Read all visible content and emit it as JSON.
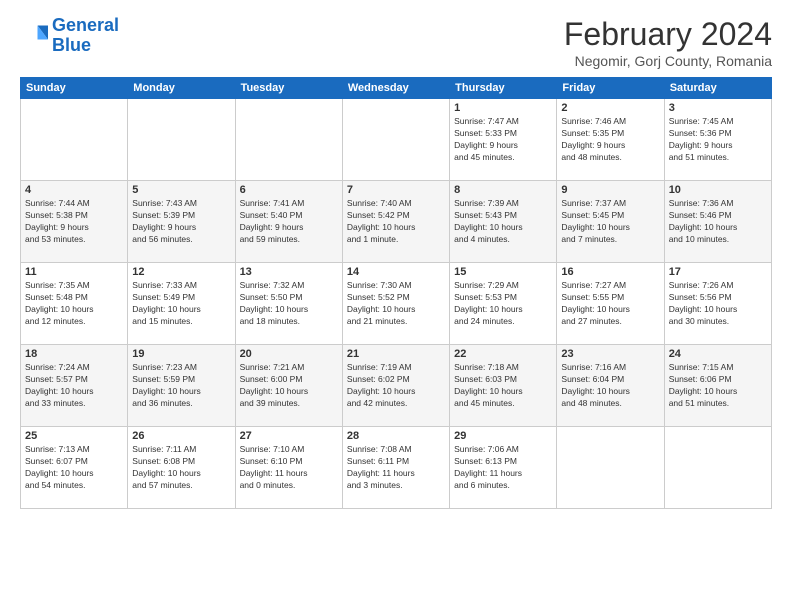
{
  "header": {
    "logo_line1": "General",
    "logo_line2": "Blue",
    "title": "February 2024",
    "subtitle": "Negomir, Gorj County, Romania"
  },
  "weekdays": [
    "Sunday",
    "Monday",
    "Tuesday",
    "Wednesday",
    "Thursday",
    "Friday",
    "Saturday"
  ],
  "weeks": [
    [
      {
        "day": "",
        "info": ""
      },
      {
        "day": "",
        "info": ""
      },
      {
        "day": "",
        "info": ""
      },
      {
        "day": "",
        "info": ""
      },
      {
        "day": "1",
        "info": "Sunrise: 7:47 AM\nSunset: 5:33 PM\nDaylight: 9 hours\nand 45 minutes."
      },
      {
        "day": "2",
        "info": "Sunrise: 7:46 AM\nSunset: 5:35 PM\nDaylight: 9 hours\nand 48 minutes."
      },
      {
        "day": "3",
        "info": "Sunrise: 7:45 AM\nSunset: 5:36 PM\nDaylight: 9 hours\nand 51 minutes."
      }
    ],
    [
      {
        "day": "4",
        "info": "Sunrise: 7:44 AM\nSunset: 5:38 PM\nDaylight: 9 hours\nand 53 minutes."
      },
      {
        "day": "5",
        "info": "Sunrise: 7:43 AM\nSunset: 5:39 PM\nDaylight: 9 hours\nand 56 minutes."
      },
      {
        "day": "6",
        "info": "Sunrise: 7:41 AM\nSunset: 5:40 PM\nDaylight: 9 hours\nand 59 minutes."
      },
      {
        "day": "7",
        "info": "Sunrise: 7:40 AM\nSunset: 5:42 PM\nDaylight: 10 hours\nand 1 minute."
      },
      {
        "day": "8",
        "info": "Sunrise: 7:39 AM\nSunset: 5:43 PM\nDaylight: 10 hours\nand 4 minutes."
      },
      {
        "day": "9",
        "info": "Sunrise: 7:37 AM\nSunset: 5:45 PM\nDaylight: 10 hours\nand 7 minutes."
      },
      {
        "day": "10",
        "info": "Sunrise: 7:36 AM\nSunset: 5:46 PM\nDaylight: 10 hours\nand 10 minutes."
      }
    ],
    [
      {
        "day": "11",
        "info": "Sunrise: 7:35 AM\nSunset: 5:48 PM\nDaylight: 10 hours\nand 12 minutes."
      },
      {
        "day": "12",
        "info": "Sunrise: 7:33 AM\nSunset: 5:49 PM\nDaylight: 10 hours\nand 15 minutes."
      },
      {
        "day": "13",
        "info": "Sunrise: 7:32 AM\nSunset: 5:50 PM\nDaylight: 10 hours\nand 18 minutes."
      },
      {
        "day": "14",
        "info": "Sunrise: 7:30 AM\nSunset: 5:52 PM\nDaylight: 10 hours\nand 21 minutes."
      },
      {
        "day": "15",
        "info": "Sunrise: 7:29 AM\nSunset: 5:53 PM\nDaylight: 10 hours\nand 24 minutes."
      },
      {
        "day": "16",
        "info": "Sunrise: 7:27 AM\nSunset: 5:55 PM\nDaylight: 10 hours\nand 27 minutes."
      },
      {
        "day": "17",
        "info": "Sunrise: 7:26 AM\nSunset: 5:56 PM\nDaylight: 10 hours\nand 30 minutes."
      }
    ],
    [
      {
        "day": "18",
        "info": "Sunrise: 7:24 AM\nSunset: 5:57 PM\nDaylight: 10 hours\nand 33 minutes."
      },
      {
        "day": "19",
        "info": "Sunrise: 7:23 AM\nSunset: 5:59 PM\nDaylight: 10 hours\nand 36 minutes."
      },
      {
        "day": "20",
        "info": "Sunrise: 7:21 AM\nSunset: 6:00 PM\nDaylight: 10 hours\nand 39 minutes."
      },
      {
        "day": "21",
        "info": "Sunrise: 7:19 AM\nSunset: 6:02 PM\nDaylight: 10 hours\nand 42 minutes."
      },
      {
        "day": "22",
        "info": "Sunrise: 7:18 AM\nSunset: 6:03 PM\nDaylight: 10 hours\nand 45 minutes."
      },
      {
        "day": "23",
        "info": "Sunrise: 7:16 AM\nSunset: 6:04 PM\nDaylight: 10 hours\nand 48 minutes."
      },
      {
        "day": "24",
        "info": "Sunrise: 7:15 AM\nSunset: 6:06 PM\nDaylight: 10 hours\nand 51 minutes."
      }
    ],
    [
      {
        "day": "25",
        "info": "Sunrise: 7:13 AM\nSunset: 6:07 PM\nDaylight: 10 hours\nand 54 minutes."
      },
      {
        "day": "26",
        "info": "Sunrise: 7:11 AM\nSunset: 6:08 PM\nDaylight: 10 hours\nand 57 minutes."
      },
      {
        "day": "27",
        "info": "Sunrise: 7:10 AM\nSunset: 6:10 PM\nDaylight: 11 hours\nand 0 minutes."
      },
      {
        "day": "28",
        "info": "Sunrise: 7:08 AM\nSunset: 6:11 PM\nDaylight: 11 hours\nand 3 minutes."
      },
      {
        "day": "29",
        "info": "Sunrise: 7:06 AM\nSunset: 6:13 PM\nDaylight: 11 hours\nand 6 minutes."
      },
      {
        "day": "",
        "info": ""
      },
      {
        "day": "",
        "info": ""
      }
    ]
  ]
}
